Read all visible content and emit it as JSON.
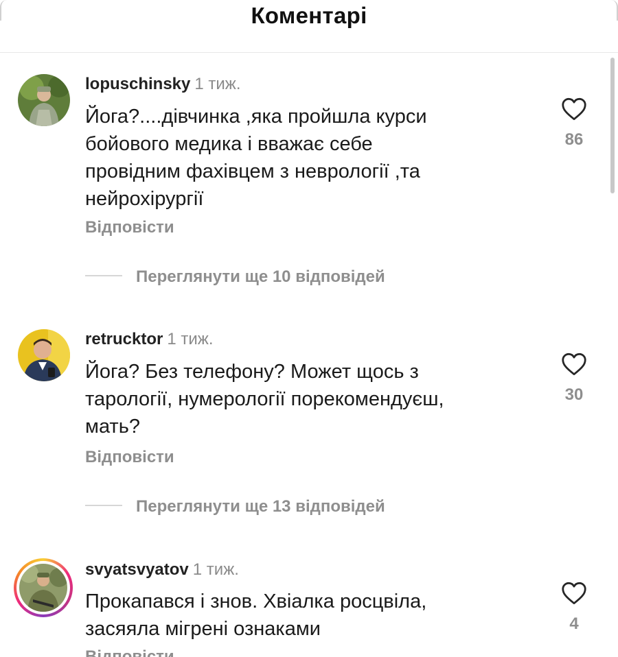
{
  "header": {
    "title": "Коментарі"
  },
  "comments": [
    {
      "username": "lopuschinsky",
      "time": "1 тиж.",
      "text": "Йога?....дівчинка ,яка пройшла курси\nбойового медика і вважає себе\nпровідним фахівцем з неврології ,та\nнейрохірургії",
      "reply_label": "Відповісти",
      "likes": "86",
      "view_more": "Переглянути ще 10 відповідей"
    },
    {
      "username": "retrucktor",
      "time": "1 тиж.",
      "text": "Йога? Без телефону? Может щось з\nтарології, нумерології порекомендуєш,\nмать?",
      "reply_label": "Відповісти",
      "likes": "30",
      "view_more": "Переглянути ще 13 відповідей"
    },
    {
      "username": "svyatsvyatov",
      "time": "1 тиж.",
      "text": "Прокапався і знов. Хвіалка росцвіла,\nзасяяла мігрені ознаками",
      "reply_label": "Відповісти",
      "likes": "4"
    }
  ],
  "icons": {
    "like": "heart-outline-icon"
  },
  "colors": {
    "text": "#1a1a1a",
    "muted": "#8e8e8e",
    "story_ring": "#ee2a7b"
  }
}
